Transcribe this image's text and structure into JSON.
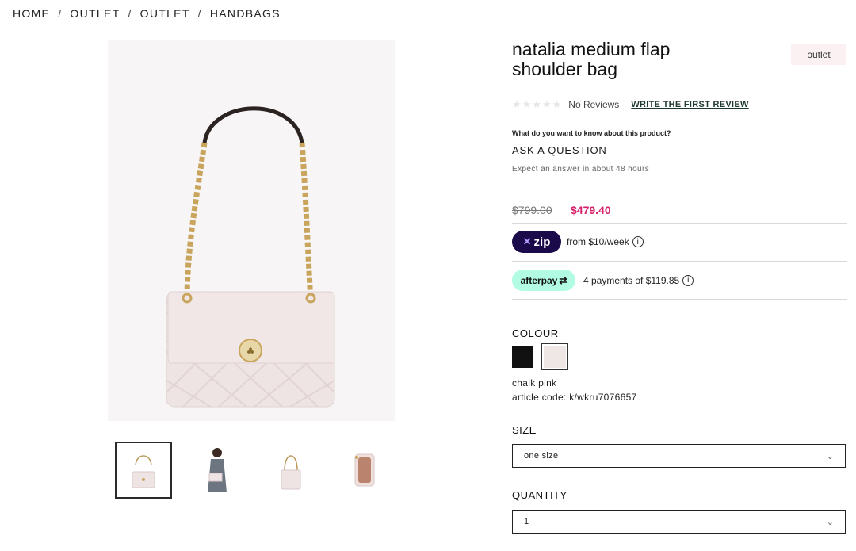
{
  "breadcrumb": {
    "items": [
      "HOME",
      "OUTLET",
      "OUTLET",
      "HANDBAGS"
    ],
    "separator": "/"
  },
  "product": {
    "title_line1": "natalia medium flap",
    "title_line2": "shoulder bag",
    "badge": "outlet",
    "stars_rating": 0,
    "stars_max": 5,
    "no_reviews": "No Reviews",
    "write_review": "WRITE THE FIRST REVIEW",
    "question_prompt": "What do you want to know about this product?",
    "ask_question": "ASK A QUESTION",
    "expect_answer": "Expect an answer in about 48 hours",
    "price_original": "$799.00",
    "price_sale": "$479.40",
    "zip": {
      "logo": "zip",
      "text": "from $10/week",
      "info": "i"
    },
    "afterpay": {
      "logo": "afterpay",
      "text": "4 payments of $119.85",
      "info": "i"
    },
    "colour": {
      "label": "COLOUR",
      "swatches": [
        {
          "name": "black",
          "color": "#111111"
        },
        {
          "name": "chalk pink",
          "color": "#efe6e6",
          "selected": true
        }
      ],
      "selected_name": "chalk pink",
      "article_code": "article code: k/wkru7076657"
    },
    "size": {
      "label": "SIZE",
      "value": "one size"
    },
    "quantity": {
      "label": "QUANTITY",
      "value": "1"
    }
  },
  "gallery": {
    "thumbnail_count": 4,
    "active_index": 0
  },
  "colors": {
    "sale_price": "#d6226a",
    "zip_bg": "#1a0a4a",
    "afterpay_bg": "#b2fce4",
    "bag": "#efe4e4"
  }
}
